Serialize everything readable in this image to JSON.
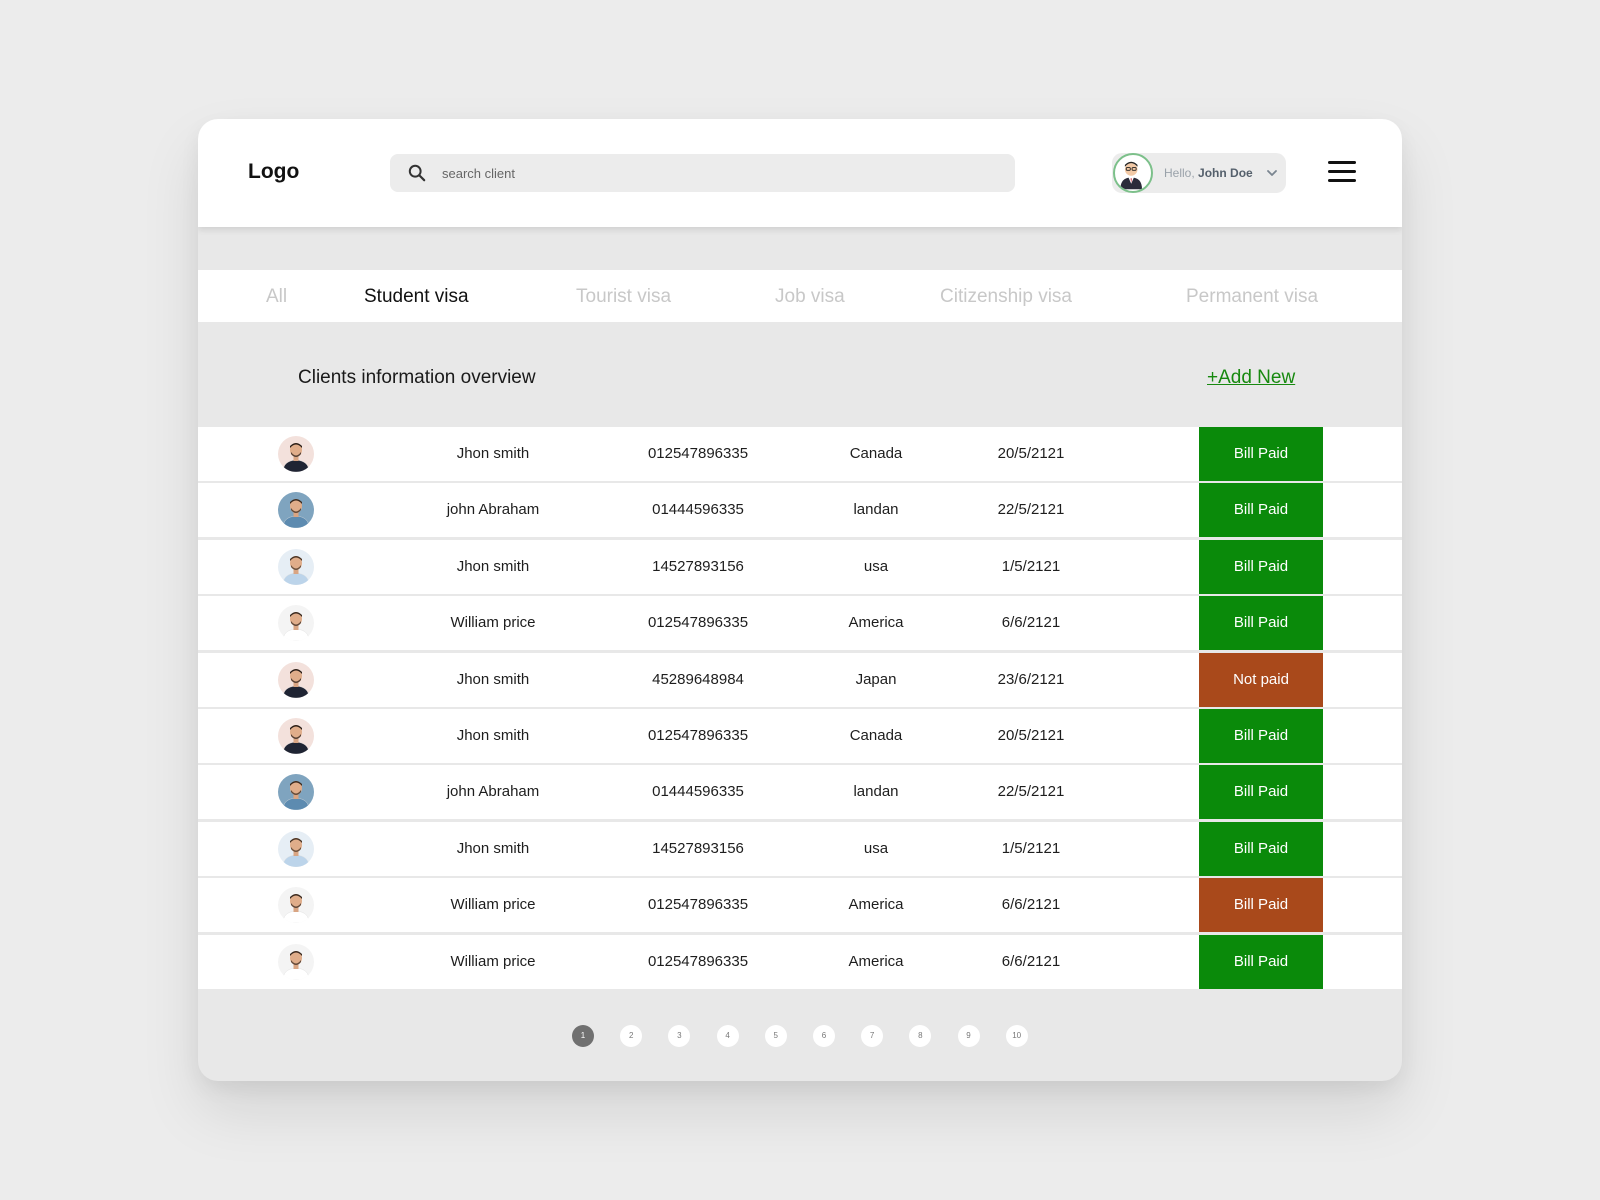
{
  "header": {
    "logo": "Logo",
    "search": {
      "placeholder": "search client",
      "value": ""
    },
    "user": {
      "greeting": "Hello,",
      "name": "John Doe"
    }
  },
  "tabs": [
    {
      "label": "All",
      "active": false
    },
    {
      "label": "Student visa",
      "active": true
    },
    {
      "label": "Tourist visa",
      "active": false
    },
    {
      "label": "Job visa",
      "active": false
    },
    {
      "label": "Citizenship visa",
      "active": false
    },
    {
      "label": "Permanent visa",
      "active": false
    }
  ],
  "section": {
    "title": "Clients information overview",
    "add_label": "+Add New"
  },
  "clients": [
    {
      "avatar": "man-dark-shirt",
      "name": "Jhon smith",
      "phone": "012547896335",
      "country": "Canada",
      "date": "20/5/2121",
      "status": "Bill Paid",
      "status_color": "#0a8a0a"
    },
    {
      "avatar": "man-blue-shirt",
      "name": "john Abraham",
      "phone": "01444596335",
      "country": "landan",
      "date": "22/5/2121",
      "status": "Bill Paid",
      "status_color": "#0a8a0a"
    },
    {
      "avatar": "man-light-shirt",
      "name": "Jhon smith",
      "phone": "14527893156",
      "country": "usa",
      "date": "1/5/2121",
      "status": "Bill Paid",
      "status_color": "#0a8a0a"
    },
    {
      "avatar": "man-white-shirt",
      "name": "William price",
      "phone": "012547896335",
      "country": "America",
      "date": "6/6/2121",
      "status": "Bill Paid",
      "status_color": "#0a8a0a"
    },
    {
      "avatar": "man-dark-shirt",
      "name": "Jhon smith",
      "phone": "45289648984",
      "country": "Japan",
      "date": "23/6/2121",
      "status": "Not paid",
      "status_color": "#a9491b"
    },
    {
      "avatar": "man-dark-shirt",
      "name": "Jhon smith",
      "phone": "012547896335",
      "country": "Canada",
      "date": "20/5/2121",
      "status": "Bill Paid",
      "status_color": "#0a8a0a"
    },
    {
      "avatar": "man-blue-shirt",
      "name": "john Abraham",
      "phone": "01444596335",
      "country": "landan",
      "date": "22/5/2121",
      "status": "Bill Paid",
      "status_color": "#0a8a0a"
    },
    {
      "avatar": "man-light-shirt",
      "name": "Jhon smith",
      "phone": "14527893156",
      "country": "usa",
      "date": "1/5/2121",
      "status": "Bill Paid",
      "status_color": "#0a8a0a"
    },
    {
      "avatar": "man-white-shirt",
      "name": "William price",
      "phone": "012547896335",
      "country": "America",
      "date": "6/6/2121",
      "status": "Bill Paid",
      "status_color": "#a9491b"
    },
    {
      "avatar": "man-white-shirt",
      "name": "William price",
      "phone": "012547896335",
      "country": "America",
      "date": "6/6/2121",
      "status": "Bill Paid",
      "status_color": "#0a8a0a"
    }
  ],
  "pagination": {
    "pages": [
      "1",
      "2",
      "3",
      "4",
      "5",
      "6",
      "7",
      "8",
      "9",
      "10"
    ],
    "current": "1"
  },
  "icons": {
    "search": "search-icon",
    "user_avatar": "user-avatar-icon",
    "dropdown": "chevron-down-icon",
    "menu": "hamburger-menu-icon"
  },
  "colors": {
    "paid": "#0a8a0a",
    "unpaid": "#a9491b",
    "accent_link": "#17890f"
  }
}
